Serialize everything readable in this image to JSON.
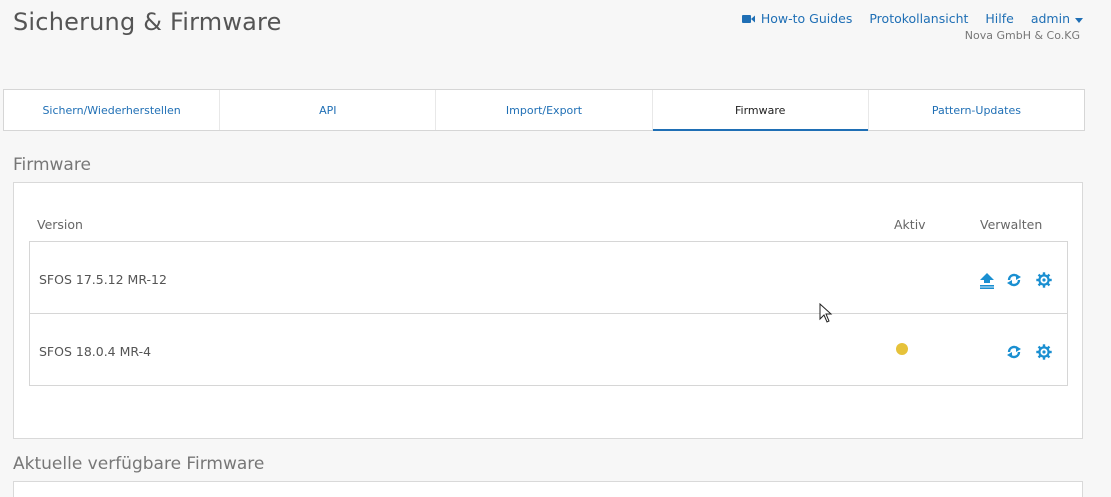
{
  "page": {
    "title": "Sicherung & Firmware"
  },
  "top_nav": {
    "howto_label": "How-to Guides",
    "log_label": "Protokollansicht",
    "help_label": "Hilfe",
    "user_label": "admin",
    "company": "Nova GmbH & Co.KG"
  },
  "tabs": [
    {
      "label": "Sichern/Wiederherstellen",
      "active": false
    },
    {
      "label": "API",
      "active": false
    },
    {
      "label": "Import/Export",
      "active": false
    },
    {
      "label": "Firmware",
      "active": true
    },
    {
      "label": "Pattern-Updates",
      "active": false
    }
  ],
  "firmware_section": {
    "title": "Firmware",
    "columns": {
      "version": "Version",
      "active": "Aktiv",
      "manage": "Verwalten"
    },
    "rows": [
      {
        "version": "SFOS 17.5.12 MR-12",
        "active": false,
        "actions": [
          "boot-upload-icon",
          "reboot-icon",
          "settings-icon"
        ]
      },
      {
        "version": "SFOS 18.0.4 MR-4",
        "active": true,
        "actions": [
          "reboot-icon",
          "settings-icon"
        ]
      }
    ]
  },
  "available_section": {
    "title": "Aktuelle verfügbare Firmware"
  },
  "colors": {
    "accent": "#1f6fb5",
    "icon": "#1a8fd1",
    "active_dot": "#e6c23a"
  }
}
